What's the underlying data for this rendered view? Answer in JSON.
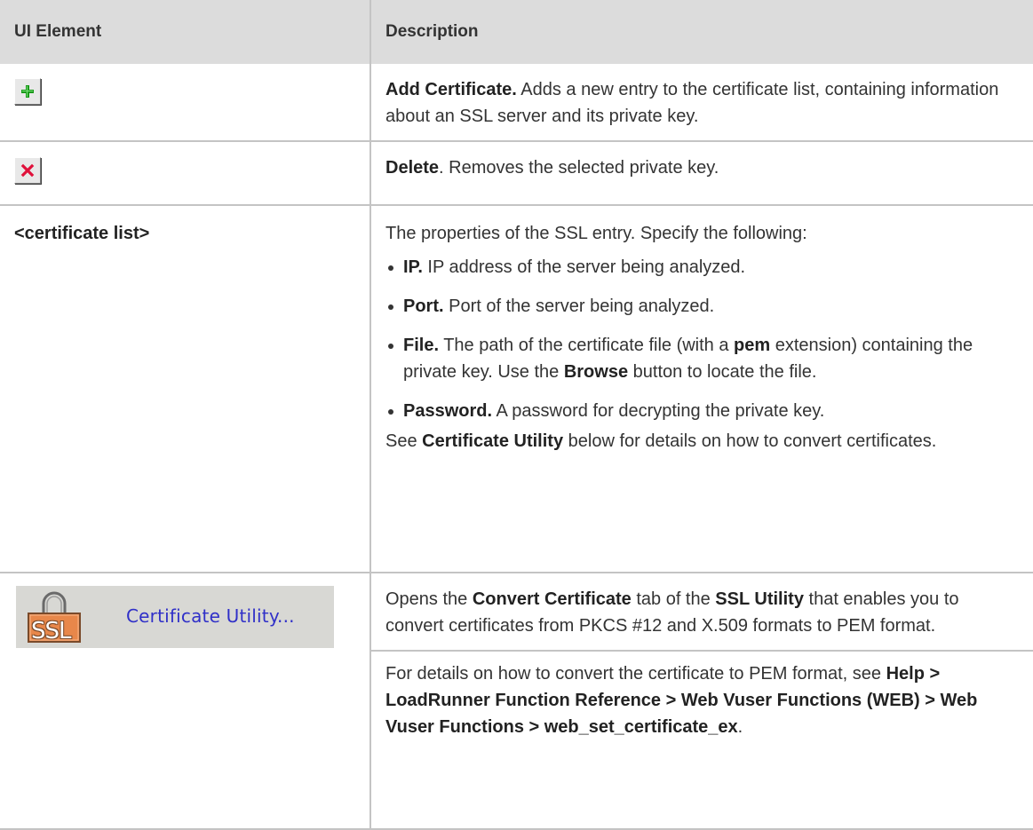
{
  "header": {
    "col1": "UI Element",
    "col2": "Description"
  },
  "rows": {
    "add": {
      "icon": "add-certificate-icon",
      "title": "Add Certificate.",
      "text": " Adds a new entry to the certificate list, containing information about an SSL server and its private key."
    },
    "delete": {
      "icon": "delete-icon",
      "title": "Delete",
      "text": ". Removes the selected private key."
    },
    "certlist": {
      "element": "<certificate list>",
      "intro": "The properties of the SSL entry. Specify the following:",
      "ip": {
        "title": "IP.",
        "text": " IP address of the server being analyzed."
      },
      "port": {
        "title": "Port.",
        "text": " Port of the server being analyzed."
      },
      "file": {
        "title": "File.",
        "t1": " The path of the certificate file (with a ",
        "pem": "pem",
        "t2": " extension) containing the private key. Use the ",
        "browse": "Browse",
        "t3": " button to locate the file."
      },
      "password": {
        "title": "Password.",
        "text": " A password for decrypting the private key."
      },
      "see": {
        "t1": "See ",
        "link": "Certificate Utility",
        "t2": " below for details on how to convert certificates."
      }
    },
    "utility": {
      "button_text": "Certificate Utility...",
      "lock_text": "SSL",
      "p1": {
        "t1": "Opens the ",
        "b1": "Convert Certificate",
        "t2": " tab of the ",
        "b2": "SSL Utility",
        "t3": " that enables you to convert certificates from PKCS #12 and X.509 formats to PEM format."
      },
      "p2": {
        "t1": "For details on how to convert the certificate to PEM format, see ",
        "path": "Help > LoadRunner Function Reference > Web Vuser Functions (WEB) > Web Vuser Functions > web_set_certificate_ex",
        "t2": "."
      }
    }
  },
  "colors": {
    "header_bg": "#dcdcdc",
    "grid": "#c4c4c4",
    "link_blue": "#3030c8",
    "lock_orange": "#e8874a"
  }
}
